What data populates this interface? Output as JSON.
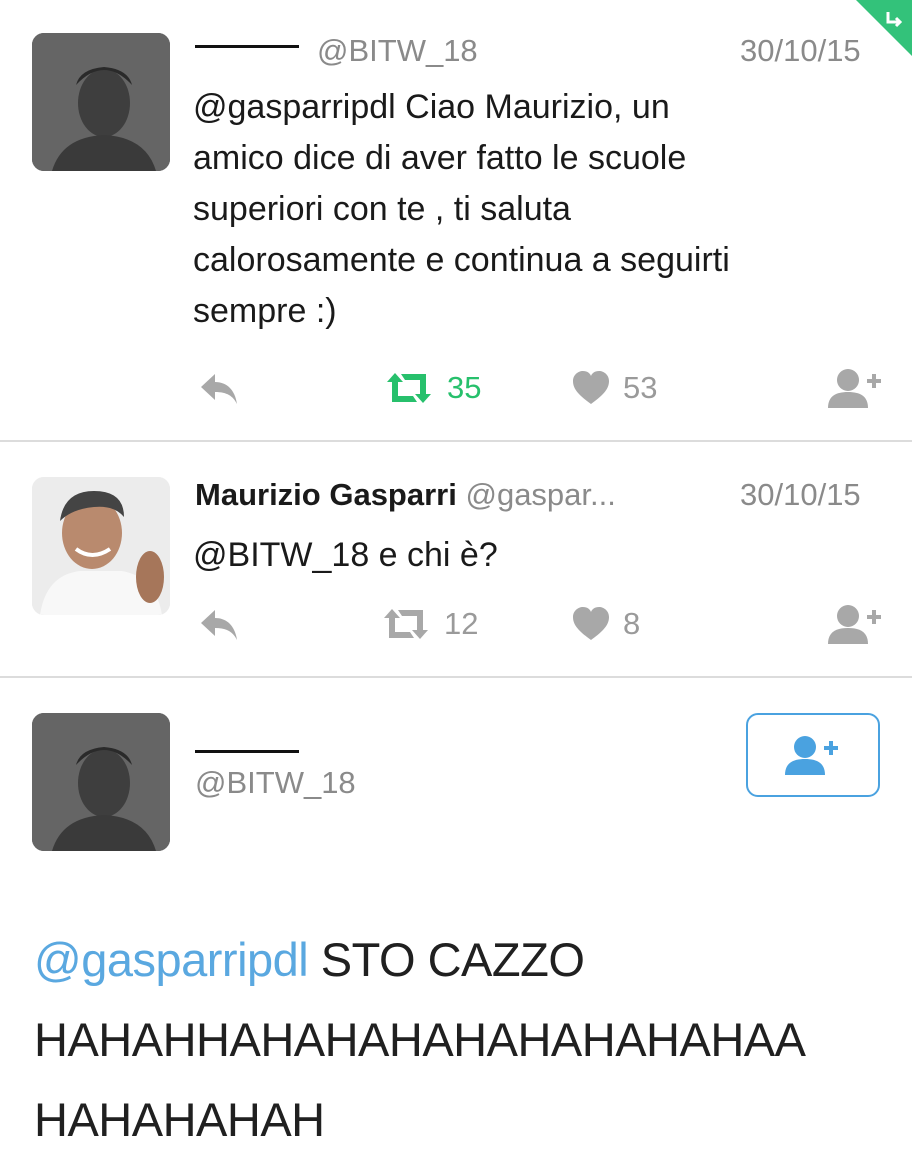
{
  "tweets": [
    {
      "handle": "@BITW_18",
      "date": "30/10/15",
      "text_lines": [
        "@gasparripdl Ciao Maurizio, un",
        "amico dice di aver fatto le scuole",
        "superiori con te , ti saluta",
        "calorosamente e continua a seguirti",
        "sempre :)"
      ],
      "retweets": "35",
      "likes": "53"
    },
    {
      "name": "Maurizio Gasparri",
      "handle": "@gaspar...",
      "date": "30/10/15",
      "text": "@BITW_18 e chi è?",
      "retweets": "12",
      "likes": "8"
    }
  ],
  "detail": {
    "handle": "@BITW_18",
    "mention": "@gasparripdl",
    "line1_rest": " STO CAZZO",
    "line2": "HAHAHHAHAHAHAHAHAHAHAHAA",
    "line3": "HAHAHAHAH"
  },
  "icons": {
    "reply": "reply-icon",
    "retweet": "retweet-icon",
    "like": "heart-icon",
    "follow": "follow-user-icon"
  },
  "colors": {
    "retweet_active": "#27c06c",
    "mention": "#5aa8e0",
    "follow_border": "#4aa2e0",
    "muted": "#8a8a8a"
  }
}
